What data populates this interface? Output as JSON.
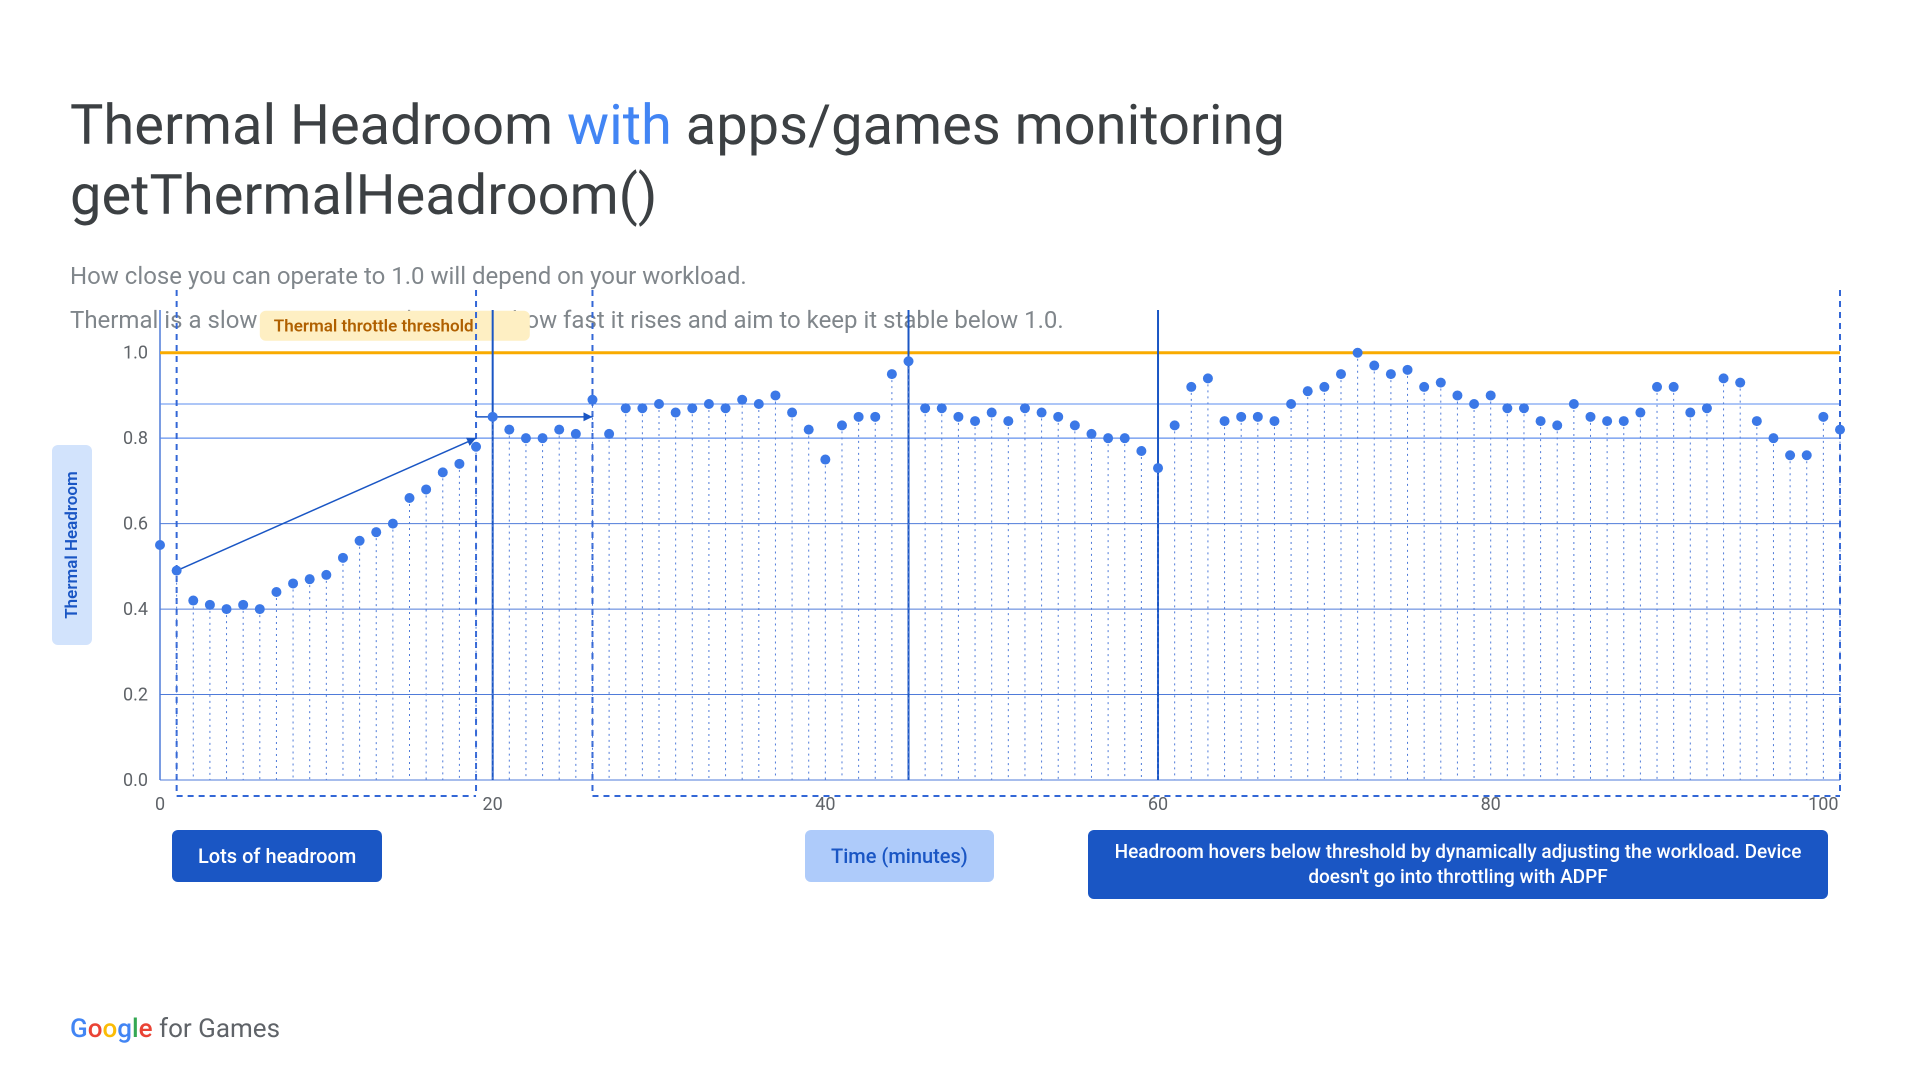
{
  "title_pre": "Thermal Headroom ",
  "title_accent": "with",
  "title_post": " apps/games monitoring getThermalHeadroom()",
  "subtitle_line1": "How close you can operate to 1.0 will depend on your workload.",
  "subtitle_line2": "Thermal is a slow moving signal; monitor how fast it rises and aim to keep it stable below 1.0.",
  "ylabel": "Thermal Headroom",
  "xlabel": "Time (minutes)",
  "annotation_left": "Lots of headroom",
  "annotation_right": "Headroom hovers below threshold by dynamically adjusting the workload. Device doesn't go into throttling with ADPF",
  "threshold_label": "Thermal throttle threshold",
  "footer_for": " for Games",
  "chart_data": {
    "type": "scatter",
    "title": "Thermal Headroom with apps/games monitoring getThermalHeadroom()",
    "xlabel": "Time (minutes)",
    "ylabel": "Thermal Headroom",
    "xlim": [
      0,
      101
    ],
    "ylim": [
      0.0,
      1.1
    ],
    "xticks": [
      0,
      20,
      40,
      60,
      80,
      100
    ],
    "yticks": [
      0.0,
      0.2,
      0.4,
      0.6,
      0.8,
      1.0
    ],
    "threshold": 1.0,
    "region_dividers_x": [
      1,
      19,
      26,
      101
    ],
    "vertical_guides_x": [
      20,
      45,
      60
    ],
    "horizontal_guides_y": [
      0.8,
      0.88
    ],
    "trend_arrows": [
      {
        "x1": 1,
        "y1": 0.49,
        "x2": 19,
        "y2": 0.8
      },
      {
        "x1": 19,
        "y1": 0.85,
        "x2": 26,
        "y2": 0.85
      }
    ],
    "series": [
      {
        "name": "Thermal Headroom",
        "x": [
          0,
          1,
          2,
          3,
          4,
          5,
          6,
          7,
          8,
          9,
          10,
          11,
          12,
          13,
          14,
          15,
          16,
          17,
          18,
          19,
          20,
          21,
          22,
          23,
          24,
          25,
          26,
          27,
          28,
          29,
          30,
          31,
          32,
          33,
          34,
          35,
          36,
          37,
          38,
          39,
          40,
          41,
          42,
          43,
          44,
          45,
          46,
          47,
          48,
          49,
          50,
          51,
          52,
          53,
          54,
          55,
          56,
          57,
          58,
          59,
          60,
          61,
          62,
          63,
          64,
          65,
          66,
          67,
          68,
          69,
          70,
          71,
          72,
          73,
          74,
          75,
          76,
          77,
          78,
          79,
          80,
          81,
          82,
          83,
          84,
          85,
          86,
          87,
          88,
          89,
          90,
          91,
          92,
          93,
          94,
          95,
          96,
          97,
          98,
          99,
          100,
          101
        ],
        "values": [
          0.55,
          0.49,
          0.42,
          0.41,
          0.4,
          0.41,
          0.4,
          0.44,
          0.46,
          0.47,
          0.48,
          0.52,
          0.56,
          0.58,
          0.6,
          0.66,
          0.68,
          0.72,
          0.74,
          0.78,
          0.85,
          0.82,
          0.8,
          0.8,
          0.82,
          0.81,
          0.89,
          0.81,
          0.87,
          0.87,
          0.88,
          0.86,
          0.87,
          0.88,
          0.87,
          0.89,
          0.88,
          0.9,
          0.86,
          0.82,
          0.75,
          0.83,
          0.85,
          0.85,
          0.95,
          0.98,
          0.87,
          0.87,
          0.85,
          0.84,
          0.86,
          0.84,
          0.87,
          0.86,
          0.85,
          0.83,
          0.81,
          0.8,
          0.8,
          0.77,
          0.73,
          0.83,
          0.92,
          0.94,
          0.84,
          0.85,
          0.85,
          0.84,
          0.88,
          0.91,
          0.92,
          0.95,
          1.0,
          0.97,
          0.95,
          0.96,
          0.92,
          0.93,
          0.9,
          0.88,
          0.9,
          0.87,
          0.87,
          0.84,
          0.83,
          0.88,
          0.85,
          0.84,
          0.84,
          0.86,
          0.92,
          0.92,
          0.86,
          0.87,
          0.94,
          0.93,
          0.84,
          0.8,
          0.76,
          0.76,
          0.85,
          0.82
        ]
      }
    ]
  }
}
